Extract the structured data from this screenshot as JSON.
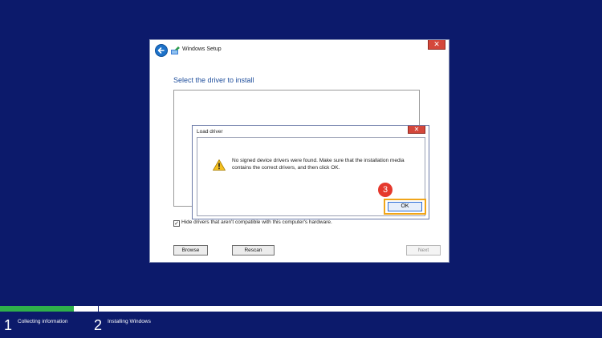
{
  "window": {
    "title": "Windows Setup",
    "close_glyph": "✕",
    "heading": "Select the driver to install",
    "hide_drivers_label": "Hide drivers that aren't compatible with this computer's hardware.",
    "hide_drivers_checked": true,
    "browse_label": "Browse",
    "rescan_label": "Rescan",
    "next_label": "Next"
  },
  "dialog": {
    "title": "Load driver",
    "close_glyph": "✕",
    "message": "No signed device drivers were found. Make sure that the installation media contains the correct drivers, and then click OK.",
    "ok_label": "OK"
  },
  "annotation": {
    "step_number": "3"
  },
  "progress": {
    "steps": [
      {
        "number": "1",
        "label": "Collecting information"
      },
      {
        "number": "2",
        "label": "Installing Windows"
      }
    ]
  },
  "colors": {
    "background": "#0c1a6b",
    "progress_green": "#2fb04a",
    "highlight": "#f0a51a",
    "badge": "#e5382c"
  }
}
